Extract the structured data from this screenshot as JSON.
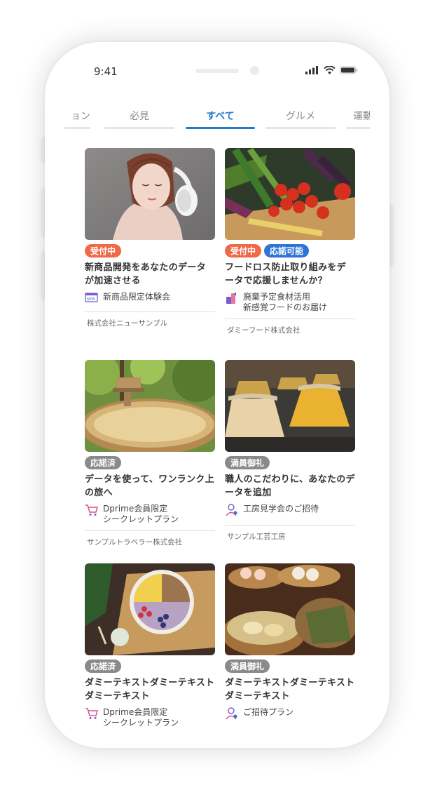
{
  "status_bar": {
    "time": "9:41"
  },
  "tabs": [
    {
      "label": "ョン",
      "active": false
    },
    {
      "label": "必見",
      "active": false
    },
    {
      "label": "すべて",
      "active": true
    },
    {
      "label": "グルメ",
      "active": false
    },
    {
      "label": "運動",
      "active": false
    }
  ],
  "cards": [
    {
      "badges": [
        "受付中"
      ],
      "title": "新商品開発をあなたのデータが加速させる",
      "benefit": "新商品限定体験会",
      "benefit_icon": "new-product-icon",
      "company": "株式会社ニューサンプル",
      "image": "woman-with-headphones"
    },
    {
      "badges": [
        "受付中",
        "応諾可能"
      ],
      "title": "フードロス防止取り組みをデータで応援しませんか？",
      "benefit": "廃棄予定食材活用\n新感覚フードのお届け",
      "benefit_icon": "food-delivery-icon",
      "company": "ダミーフード株式会社",
      "image": "vegetables"
    },
    {
      "badges": [
        "応諾済"
      ],
      "title": "データを使って、ワンランク上の旅へ",
      "benefit": "Dprime会員限定\nシークレットプラン",
      "benefit_icon": "cart-icon",
      "company": "サンプルトラベラー株式会社",
      "image": "hot-spring-bath"
    },
    {
      "badges": [
        "満員御礼"
      ],
      "title": "職人のこだわりに、あなたのデータを追加",
      "benefit": "工房見学会のご招待",
      "benefit_icon": "person-icon",
      "company": "サンプル工芸工房",
      "image": "pottery"
    },
    {
      "badges": [
        "応諾済"
      ],
      "title": "ダミーテキストダミーテキストダミーテキスト",
      "benefit": "Dprime会員限定\nシークレットプラン",
      "benefit_icon": "cart-icon",
      "company": "",
      "image": "fruit-bowl"
    },
    {
      "badges": [
        "満員御礼"
      ],
      "title": "ダミーテキストダミーテキストダミーテキスト",
      "benefit": "ご招待プラン",
      "benefit_icon": "person-icon",
      "company": "",
      "image": "dim-sum"
    }
  ],
  "colors": {
    "accent": "#2979c9",
    "badge_open": "#ef6a47",
    "badge_available": "#2e74d6",
    "badge_closed": "#8a8a8a"
  }
}
